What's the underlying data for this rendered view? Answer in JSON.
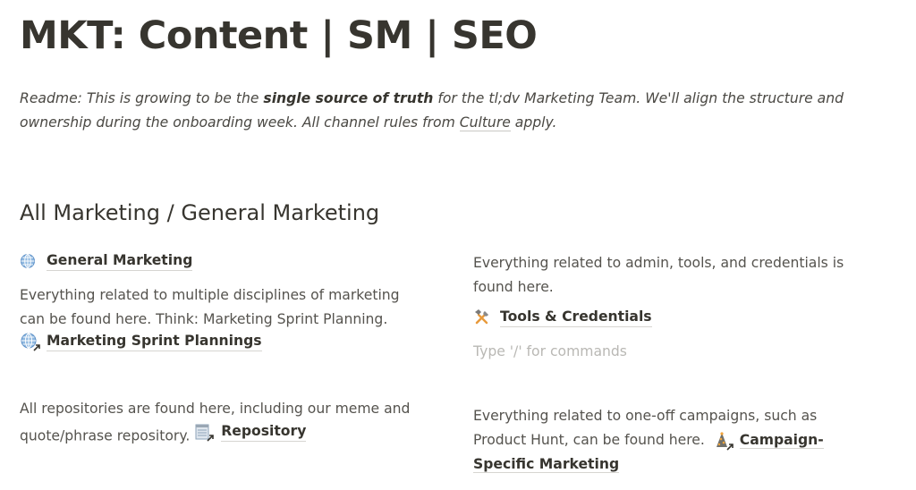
{
  "page": {
    "title": "MKT: Content | SM | SEO",
    "readme": {
      "prefix": "Readme: This is growing to be the ",
      "bold": "single source of truth",
      "middle": " for the tl;dv Marketing Team. We'll align the structure and ownership during the onboarding week. All channel rules from ",
      "link": "Culture",
      "suffix": " apply."
    },
    "section_heading": "All Marketing / General Marketing"
  },
  "left_column": {
    "general_marketing": {
      "icon": "globe-icon",
      "label": "General Marketing"
    },
    "general_desc": "Everything related to multiple disciplines of marketing can be found here. Think: Marketing Sprint Planning.",
    "sprint_link": {
      "icon": "globe-link-icon",
      "label": "Marketing Sprint Plannings"
    },
    "repo_desc": "All repositories are found here, including our meme and quote/phrase repository.",
    "repo_link": {
      "icon": "notepad-link-icon",
      "label": "Repository"
    }
  },
  "right_column": {
    "tools_desc": "Everything related to admin, tools, and credentials is found here.",
    "tools_link": {
      "icon": "hammer-wrench-icon",
      "label": "Tools & Credentials"
    },
    "placeholder": "Type '/' for commands",
    "campaign_desc": "Everything related to one-off campaigns, such as Product Hunt, can be found here.",
    "campaign_link": {
      "icon": "christmas-tree-link-icon",
      "label": "Campaign-Specific Marketing"
    }
  }
}
